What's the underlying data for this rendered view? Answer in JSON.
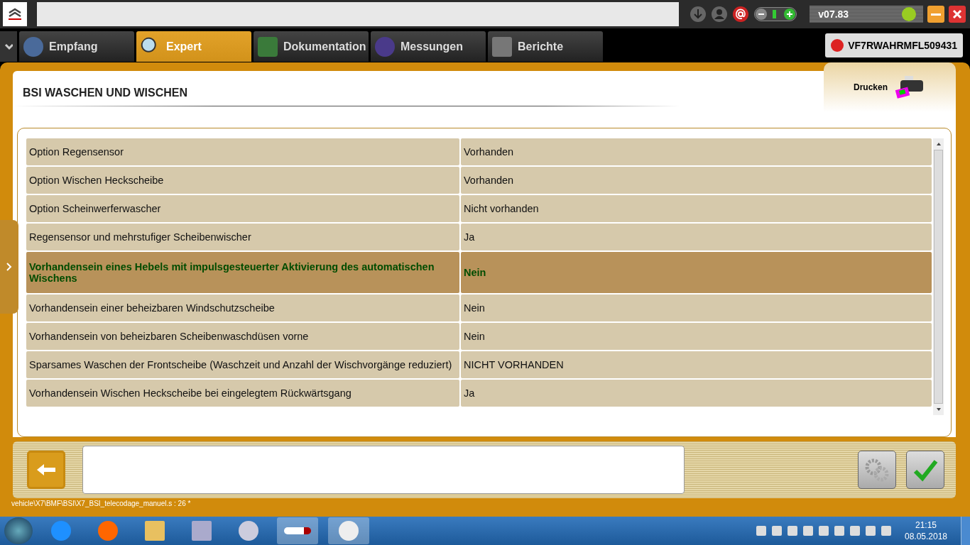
{
  "header": {
    "version": "v07.83",
    "vin": "VF7RWAHRMFL509431"
  },
  "tabs": [
    {
      "label": "Empfang",
      "selected": false
    },
    {
      "label": "Expert",
      "selected": true
    },
    {
      "label": "Dokumentation",
      "selected": false
    },
    {
      "label": "Messungen",
      "selected": false
    },
    {
      "label": "Berichte",
      "selected": false
    }
  ],
  "page": {
    "title": "BSI  WASCHEN UND WISCHEN",
    "print_label": "Drucken"
  },
  "table": {
    "rows": [
      {
        "name": "Option Regensensor",
        "value": "Vorhanden",
        "selected": false
      },
      {
        "name": "Option Wischen Heckscheibe",
        "value": "Vorhanden",
        "selected": false
      },
      {
        "name": "Option Scheinwerferwascher",
        "value": "Nicht vorhanden",
        "selected": false
      },
      {
        "name": "Regensensor und mehrstufiger Scheibenwischer",
        "value": "Ja",
        "selected": false
      },
      {
        "name": "Vorhandensein eines Hebels mit impulsgesteuerter Aktivierung des automatischen Wischens",
        "value": "Nein",
        "selected": true
      },
      {
        "name": "Vorhandensein einer beheizbaren Windschutzscheibe",
        "value": "Nein",
        "selected": false
      },
      {
        "name": "Vorhandensein von beheizbaren Scheibenwaschdüsen vorne",
        "value": "Nein",
        "selected": false
      },
      {
        "name": "Sparsames Waschen der Frontscheibe (Waschzeit und Anzahl der Wischvorgänge reduziert)",
        "value": "NICHT VORHANDEN",
        "selected": false
      },
      {
        "name": "Vorhandensein Wischen Heckscheibe bei eingelegtem Rückwärtsgang",
        "value": "Ja",
        "selected": false
      }
    ]
  },
  "status_path": "vehicle\\X7\\BMF\\BSI\\X7_BSI_telecodage_manuel.s : 26 *",
  "taskbar": {
    "time": "21:15",
    "date": "08.05.2018"
  }
}
